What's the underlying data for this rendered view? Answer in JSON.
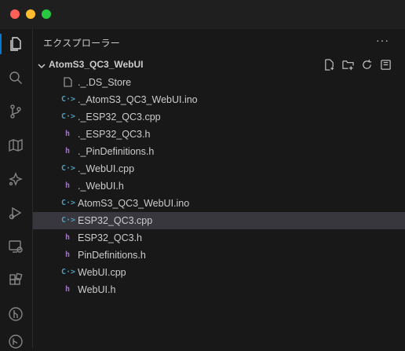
{
  "explorer": {
    "title": "エクスプローラー",
    "more_label": "···"
  },
  "folder": {
    "name": "AtomS3_QC3_WebUI",
    "actions": [
      "new-file-icon",
      "new-folder-icon",
      "refresh-icon",
      "collapse-all-icon"
    ]
  },
  "files": [
    {
      "name": "._.DS_Store",
      "icon": "file-icon",
      "type": "generic"
    },
    {
      "name": "._AtomS3_QC3_WebUI.ino",
      "icon": "cpp-icon",
      "type": "cpp",
      "glyph": "C·>"
    },
    {
      "name": "._ESP32_QC3.cpp",
      "icon": "cpp-icon",
      "type": "cpp",
      "glyph": "C·>"
    },
    {
      "name": "._ESP32_QC3.h",
      "icon": "header-icon",
      "type": "h",
      "glyph": "h"
    },
    {
      "name": "._PinDefinitions.h",
      "icon": "header-icon",
      "type": "h",
      "glyph": "h"
    },
    {
      "name": "._WebUI.cpp",
      "icon": "cpp-icon",
      "type": "cpp",
      "glyph": "C·>"
    },
    {
      "name": "._WebUI.h",
      "icon": "header-icon",
      "type": "h",
      "glyph": "h"
    },
    {
      "name": "AtomS3_QC3_WebUI.ino",
      "icon": "cpp-icon",
      "type": "cpp",
      "glyph": "C·>"
    },
    {
      "name": "ESP32_QC3.cpp",
      "icon": "cpp-icon",
      "type": "cpp",
      "glyph": "C·>",
      "selected": true
    },
    {
      "name": "ESP32_QC3.h",
      "icon": "header-icon",
      "type": "h",
      "glyph": "h"
    },
    {
      "name": "PinDefinitions.h",
      "icon": "header-icon",
      "type": "h",
      "glyph": "h"
    },
    {
      "name": "WebUI.cpp",
      "icon": "cpp-icon",
      "type": "cpp",
      "glyph": "C·>"
    },
    {
      "name": "WebUI.h",
      "icon": "header-icon",
      "type": "h",
      "glyph": "h"
    }
  ],
  "activity_bar": [
    "explorer-icon",
    "search-icon",
    "source-control-icon",
    "map-icon",
    "sparkle-icon",
    "run-debug-icon",
    "remote-explorer-icon",
    "extensions-icon",
    "git-graph-icon",
    "accounts-icon"
  ],
  "colors": {
    "background": "#181818",
    "selection": "#37373d",
    "accent": "#0078d4",
    "cpp": "#519aba",
    "header": "#a074c4"
  }
}
